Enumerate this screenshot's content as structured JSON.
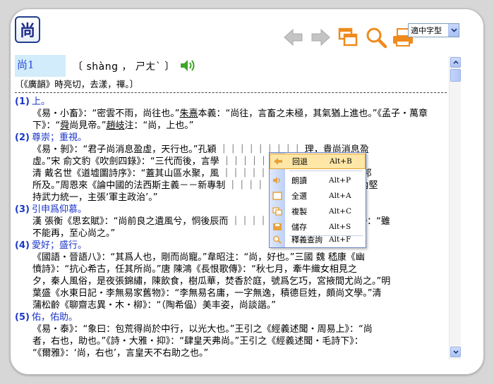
{
  "header": {
    "char_button": "尚",
    "font_select_value": "適中字型"
  },
  "entry": {
    "word": "尚1",
    "pronunciation": "〔 shàng ， ㄕㄤˋ 〕",
    "rhyme": "〔《廣韻》時亮切，去漾，禪。〕"
  },
  "senses": [
    {
      "num": "(1)",
      "title": "上。",
      "body": [
        "《易・小畜》：“密雲不雨，尚往也。”",
        "朱熹",
        "本義：“尚往，言畜之未極，其氣猶上進也。”《孟子・萬章下》：“",
        "舜",
        "尚見帝。”",
        "趙岐",
        "注：“尚，上也。”"
      ]
    },
    {
      "num": "(2)",
      "title": "尊崇；重視。",
      "body": [
        "《易・剝》：“君子尚消息盈虛，天行也。”",
        "孔穎",
        "……是尚，所以他對內堅持武力統一，主張‘軍主政治’。”"
      ],
      "lines": [
        "《易・剝》：“君子尚消息盈虛，天行也。”孔穎 ｜｜｜｜｜｜｜｜｜ 理，貴尚消息盈",
        "虛。”宋 俞文豹《吹劍四錄》：“三代而後，言學 ｜｜｜｜｜｜｜｜ 往，唐尚詞章。”",
        "清 戴名世《道墟圖詩序》：“蓋其山區水聚，風 ｜｜｜｜｜｜｜｜ 敦詩書，皆非他邦",
        "所及。”周恩來《論中國的法西斯主義－－新專制 ｜｜｜｜｜｜｜ 是尚，所以他對內堅",
        "持武力統一，主張‘軍主政治’。”"
      ]
    },
    {
      "num": "(3)",
      "title": "引申爲仰慕。",
      "lines": [
        "漢 張衡《思玄賦》：“尚前良之遺風兮，恫後辰而 ｜｜｜｜｜｜｜ 與彭咸之儔等疏》：“雖",
        "不能再，至心尚之。”"
      ]
    },
    {
      "num": "(4)",
      "title": "愛好；盛行。",
      "lines": [
        "《國語・晉語八》：“其爲人也，剛而尚寵。”韋昭注：“尚，好也。”三國 魏 嵇康《幽",
        "憤詩》：“抗心希古，任其所尚。”唐 陳鴻《長恨歌傳》：“秋七月，牽牛織女相見之",
        "夕，秦人風俗，是夜張錦繡，陳飲食，樹瓜華，焚香於庭，號爲乞巧，宮掖間尤尚之。”明",
        "葉盛《水東日記・李無易家舊物》：“李無易名庸，一字無逸，積德巨姓，頗尚文學。”清",
        "蒲松齡《聊齋志異・木・柳》：“（陶希偘）美丰姿，尚談諧。”"
      ]
    },
    {
      "num": "(5)",
      "title": "佑，佑助。",
      "lines": [
        "《易・泰》：“象曰：包荒得尚於中行，以光大也。”王引之《經義述聞・周易上》：“尚",
        "者，右也，助也。”《詩・大雅・抑》：“肆皇天弗尚。”王引之《經義述聞・毛詩下》：",
        "“《爾雅》：‘尚，右也’，言皇天不右助之也。”"
      ]
    }
  ],
  "context_menu": [
    {
      "label": "回退",
      "shortcut": "Alt+B",
      "icon": "back-icon"
    },
    {
      "label": "朗讀",
      "shortcut": "Alt+P",
      "icon": "speaker-icon"
    },
    {
      "label": "全選",
      "shortcut": "Alt+A",
      "icon": "select-all-icon"
    },
    {
      "label": "複製",
      "shortcut": "Alt+C",
      "icon": "copy-icon"
    },
    {
      "label": "儲存",
      "shortcut": "Alt+S",
      "icon": "save-icon"
    },
    {
      "label": "釋義查詢",
      "shortcut": "Alt+F",
      "icon": "lookup-icon"
    }
  ],
  "colors": {
    "accent_blue": "#1b36c9",
    "menu_highlight": "#fde6a6",
    "toolbar_orange": "#f08a1c"
  }
}
